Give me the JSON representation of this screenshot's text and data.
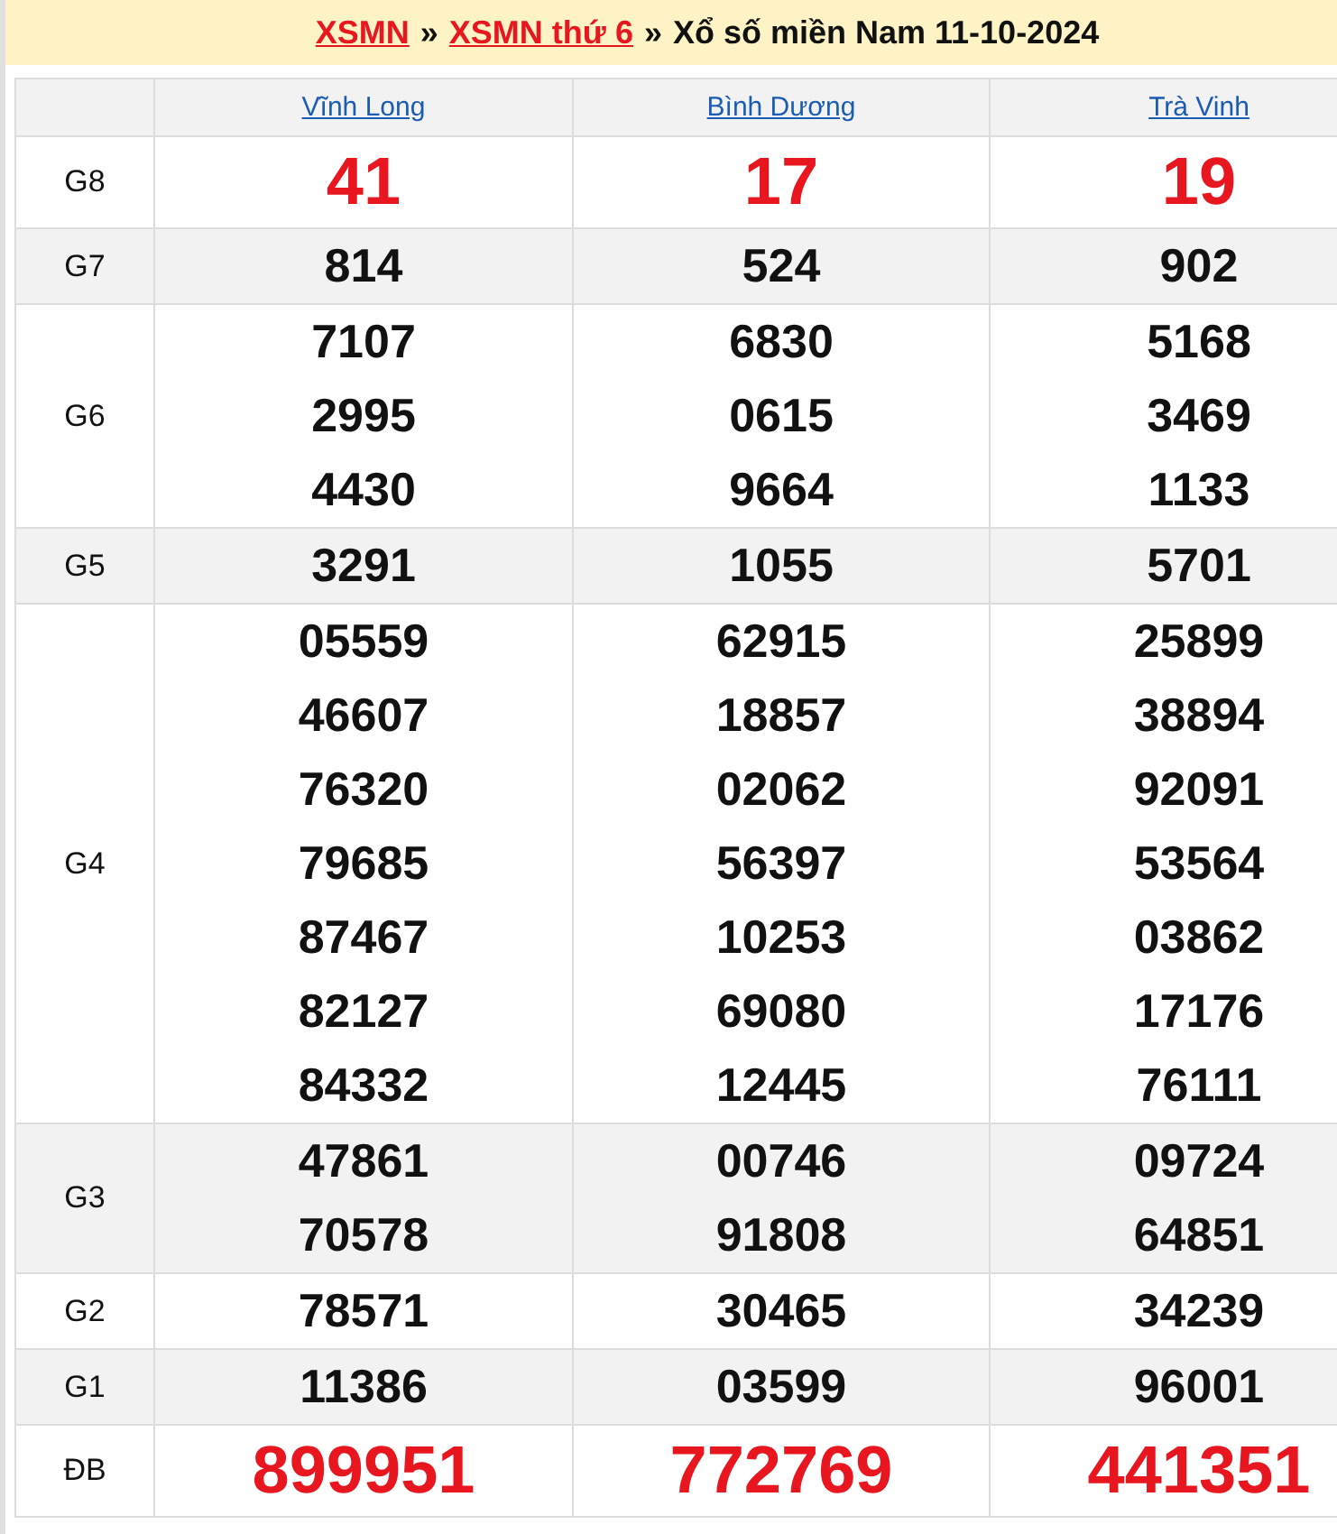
{
  "breadcrumb": [
    {
      "kind": "link",
      "text": "XSMN"
    },
    {
      "kind": "sep",
      "text": "»"
    },
    {
      "kind": "link",
      "text": "XSMN thứ 6"
    },
    {
      "kind": "sep",
      "text": "»"
    },
    {
      "kind": "title",
      "text": "Xổ số miền Nam 11-10-2024"
    }
  ],
  "table": {
    "provinces": [
      "Vĩnh Long",
      "Bình Dương",
      "Trà Vinh"
    ],
    "rows": [
      {
        "prize": "G8",
        "kind": "special",
        "cells": [
          [
            "41"
          ],
          [
            "17"
          ],
          [
            "19"
          ]
        ]
      },
      {
        "prize": "G7",
        "kind": "normal",
        "cells": [
          [
            "814"
          ],
          [
            "524"
          ],
          [
            "902"
          ]
        ]
      },
      {
        "prize": "G6",
        "kind": "normal",
        "cells": [
          [
            "7107",
            "2995",
            "4430"
          ],
          [
            "6830",
            "0615",
            "9664"
          ],
          [
            "5168",
            "3469",
            "1133"
          ]
        ]
      },
      {
        "prize": "G5",
        "kind": "normal",
        "cells": [
          [
            "3291"
          ],
          [
            "1055"
          ],
          [
            "5701"
          ]
        ]
      },
      {
        "prize": "G4",
        "kind": "normal",
        "cells": [
          [
            "05559",
            "46607",
            "76320",
            "79685",
            "87467",
            "82127",
            "84332"
          ],
          [
            "62915",
            "18857",
            "02062",
            "56397",
            "10253",
            "69080",
            "12445"
          ],
          [
            "25899",
            "38894",
            "92091",
            "53564",
            "03862",
            "17176",
            "76111"
          ]
        ]
      },
      {
        "prize": "G3",
        "kind": "normal",
        "cells": [
          [
            "47861",
            "70578"
          ],
          [
            "00746",
            "91808"
          ],
          [
            "09724",
            "64851"
          ]
        ]
      },
      {
        "prize": "G2",
        "kind": "normal",
        "cells": [
          [
            "78571"
          ],
          [
            "30465"
          ],
          [
            "34239"
          ]
        ]
      },
      {
        "prize": "G1",
        "kind": "normal",
        "cells": [
          [
            "11386"
          ],
          [
            "03599"
          ],
          [
            "96001"
          ]
        ]
      },
      {
        "prize": "ĐB",
        "kind": "special",
        "cells": [
          [
            "899951"
          ],
          [
            "772769"
          ],
          [
            "441351"
          ]
        ]
      }
    ]
  }
}
